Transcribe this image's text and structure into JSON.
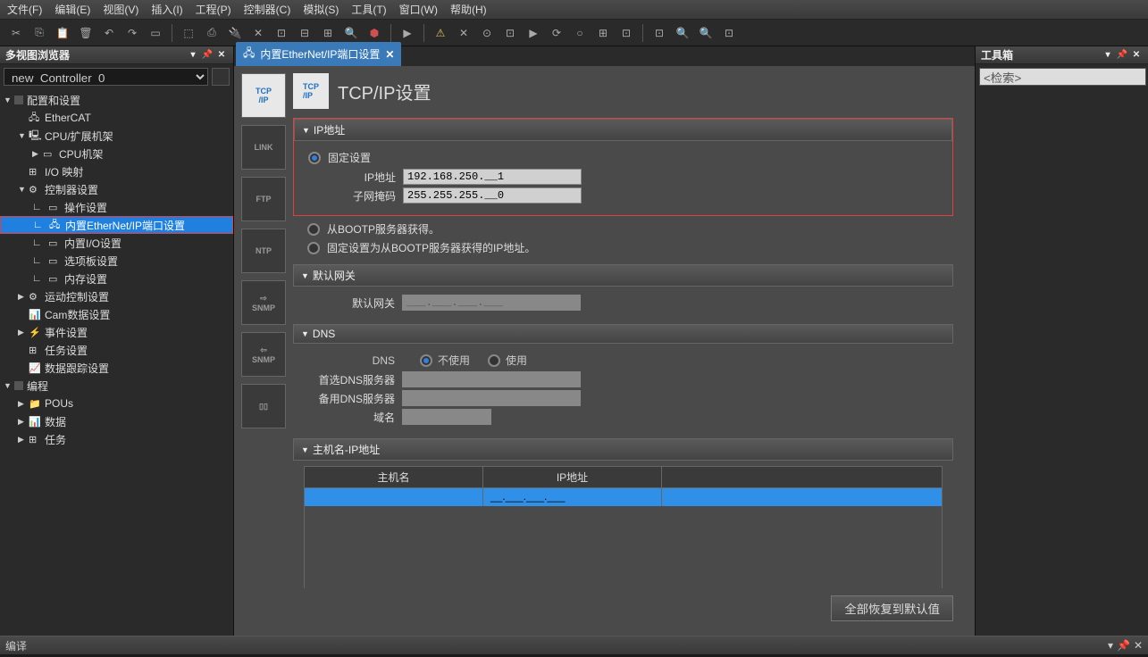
{
  "menu": {
    "file": "文件(F)",
    "edit": "编辑(E)",
    "view": "视图(V)",
    "insert": "插入(I)",
    "project": "工程(P)",
    "controller": "控制器(C)",
    "simulate": "模拟(S)",
    "tools": "工具(T)",
    "window": "窗口(W)",
    "help": "帮助(H)"
  },
  "left_panel": {
    "title": "多视图浏览器",
    "controller": "new_Controller_0",
    "tree": {
      "config": "配置和设置",
      "ethercat": "EtherCAT",
      "cpu_rack": "CPU/扩展机架",
      "cpu_frame": "CPU机架",
      "io_map": "I/O 映射",
      "ctrl_settings": "控制器设置",
      "op_settings": "操作设置",
      "ethernet_ip": "内置EtherNet/IP端口设置",
      "io_settings": "内置I/O设置",
      "option_board": "选项板设置",
      "mem_settings": "内存设置",
      "motion": "运动控制设置",
      "cam": "Cam数据设置",
      "event": "事件设置",
      "task_settings": "任务设置",
      "data_trace": "数据跟踪设置",
      "programming": "编程",
      "pous": "POUs",
      "data": "数据",
      "tasks": "任务"
    }
  },
  "tab": {
    "title": "内置EtherNet/IP端口设置"
  },
  "settings": {
    "title": "TCP/IP设置",
    "side": {
      "tcpip": "TCP/IP",
      "link": "LINK",
      "ftp": "FTP",
      "ntp": "NTP",
      "snmp_out": "SNMP",
      "snmp_in": "SNMP"
    },
    "ip_section": "IP地址",
    "fixed": "固定设置",
    "ip_label": "IP地址",
    "ip_value": "192.168.250.__1",
    "subnet_label": "子网掩码",
    "subnet_value": "255.255.255.__0",
    "bootp1": "从BOOTP服务器获得。",
    "bootp2": "固定设置为从BOOTP服务器获得的IP地址。",
    "gateway_section": "默认网关",
    "gateway_label": "默认网关",
    "gateway_value": "___.___.___.___",
    "dns_section": "DNS",
    "dns_label": "DNS",
    "dns_no": "不使用",
    "dns_yes": "使用",
    "dns_primary": "首选DNS服务器",
    "dns_secondary": "备用DNS服务器",
    "domain": "域名",
    "host_section": "主机名-IP地址",
    "host_col1": "主机名",
    "host_col2": "IP地址",
    "host_row_ip": "__.___.___.___",
    "restore": "全部恢复到默认值"
  },
  "right_panel": {
    "title": "工具箱",
    "search": "<检索>"
  },
  "bottom": {
    "title": "编译"
  }
}
